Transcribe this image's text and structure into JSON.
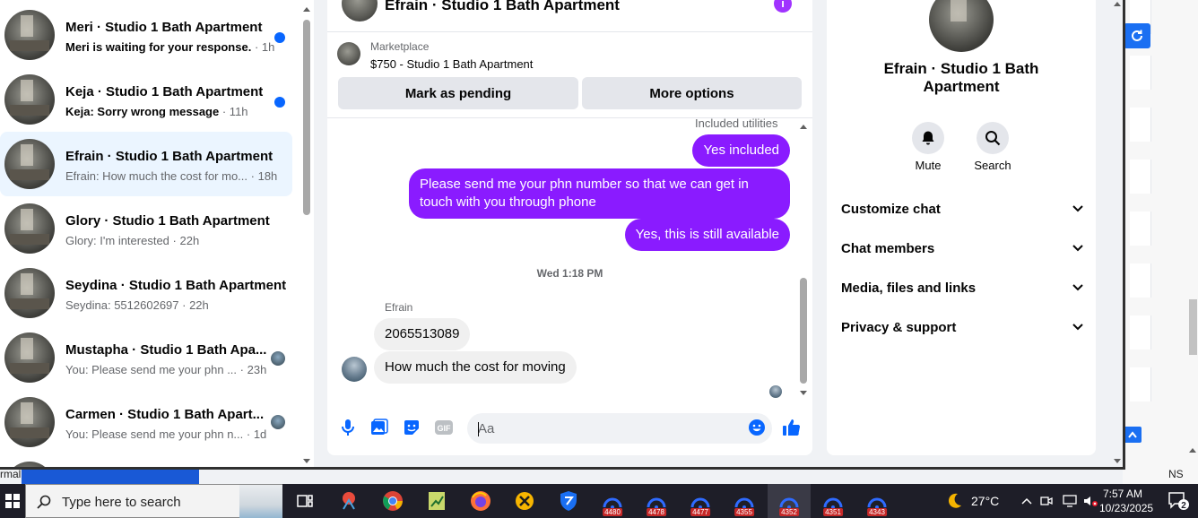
{
  "conversations": [
    {
      "name": "Meri · Studio 1 Bath Apartment",
      "preview": "Meri is waiting for your response.",
      "time": "· 1h",
      "unread": true
    },
    {
      "name": "Keja · Studio 1 Bath Apartment",
      "preview": "Keja: Sorry wrong message",
      "time": "· 11h",
      "unread": true
    },
    {
      "name": "Efrain · Studio 1 Bath Apartment",
      "preview": "Efrain: How much the cost for mo...",
      "time": "· 18h",
      "active": true
    },
    {
      "name": "Glory · Studio 1 Bath Apartment",
      "preview": "Glory: I'm interested",
      "time": "· 22h"
    },
    {
      "name": "Seydina · Studio 1 Bath Apartment",
      "preview": "Seydina: 5512602697",
      "time": "· 22h"
    },
    {
      "name": "Mustapha · Studio 1 Bath Apa...",
      "preview": "You: Please send me your phn ...",
      "time": "· 23h"
    },
    {
      "name": "Carmen · Studio 1 Bath Apart...",
      "preview": "You: Please send me your phn n...",
      "time": "· 1d"
    }
  ],
  "chat": {
    "title": "Efrain · Studio 1 Bath Apartment",
    "info_icon": "i",
    "marketplace_label": "Marketplace",
    "listing": "$750 - Studio 1 Bath Apartment",
    "mark_pending": "Mark as pending",
    "more_options": "More options",
    "utilities_text": "Included utilities",
    "messages_out": [
      "Yes included",
      "Please send me your phn number so that we can get in touch with you through phone",
      "Yes, this is still available"
    ],
    "time_separator": "Wed 1:18 PM",
    "sender_name": "Efrain",
    "messages_in": [
      "2065513089",
      "How much the cost for moving"
    ],
    "composer_placeholder": "Aa"
  },
  "info": {
    "name": "Efrain · Studio 1 Bath Apartment",
    "mute_label": "Mute",
    "search_label": "Search",
    "sections": [
      "Customize chat",
      "Chat members",
      "Media, files and links",
      "Privacy & support"
    ]
  },
  "background": {
    "left_text": "rmal",
    "right_text": "NS"
  },
  "taskbar": {
    "search_placeholder": "Type here to search",
    "badges": [
      "4480",
      "4478",
      "4477",
      "4355",
      "4352",
      "4351",
      "4343"
    ],
    "temperature": "27°C",
    "time": "7:57 AM",
    "date": "10/23/2025",
    "notification_count": "2"
  },
  "colors": {
    "accent": "#8a1bff",
    "unread_dot": "#0866ff",
    "active_conv": "#ebf5ff",
    "taskbar": "#1e1e28"
  }
}
